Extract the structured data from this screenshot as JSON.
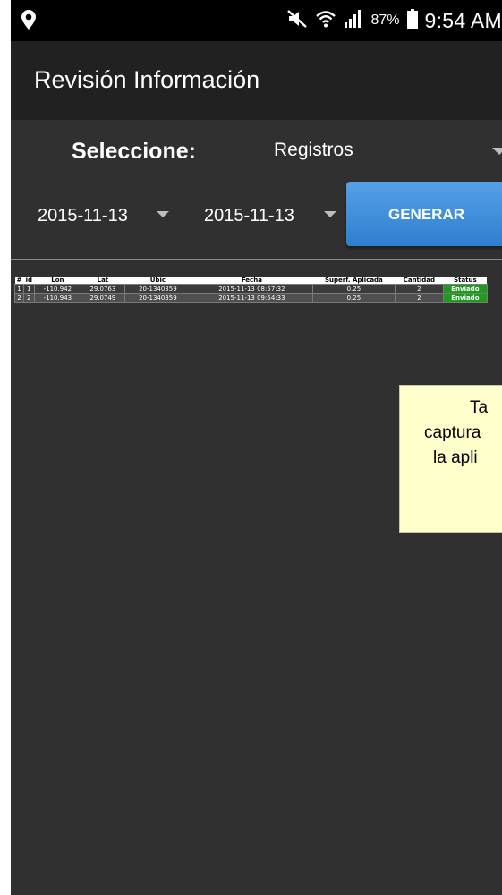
{
  "status_bar": {
    "icons": [
      "location-icon",
      "mute-icon",
      "wifi-icon",
      "signal-icon",
      "battery-icon"
    ],
    "battery_percent": "87%",
    "time": "9:54 AM"
  },
  "app": {
    "title": "Revisión Información"
  },
  "selector": {
    "label": "Seleccione:",
    "value": "Registros"
  },
  "filters": {
    "date_from": "2015-11-13",
    "date_to": "2015-11-13",
    "generate_label": "GENERAR"
  },
  "table": {
    "headers": [
      "#",
      "id",
      "Lon",
      "Lat",
      "Ubic",
      "Fecha",
      "Superf. Aplicada",
      "Cantidad",
      "Status"
    ],
    "rows": [
      [
        "1",
        "1",
        "-110.942",
        "29.0763",
        "20-1340359",
        "2015-11-13 08:57:32",
        "0.25",
        "2",
        "Enviado"
      ],
      [
        "2",
        "2",
        "-110.943",
        "29.0749",
        "20-1340359",
        "2015-11-13 09:54:33",
        "0.25",
        "2",
        "Enviado"
      ]
    ]
  },
  "tooltip": {
    "line1": "Ta",
    "line2": "captura",
    "line3": "la apli"
  },
  "colors": {
    "background": "#303030",
    "action_bar": "#212121",
    "button": "#3f8fdc",
    "status_ok": "#1e9a1e",
    "tooltip": "#ffffcc"
  }
}
